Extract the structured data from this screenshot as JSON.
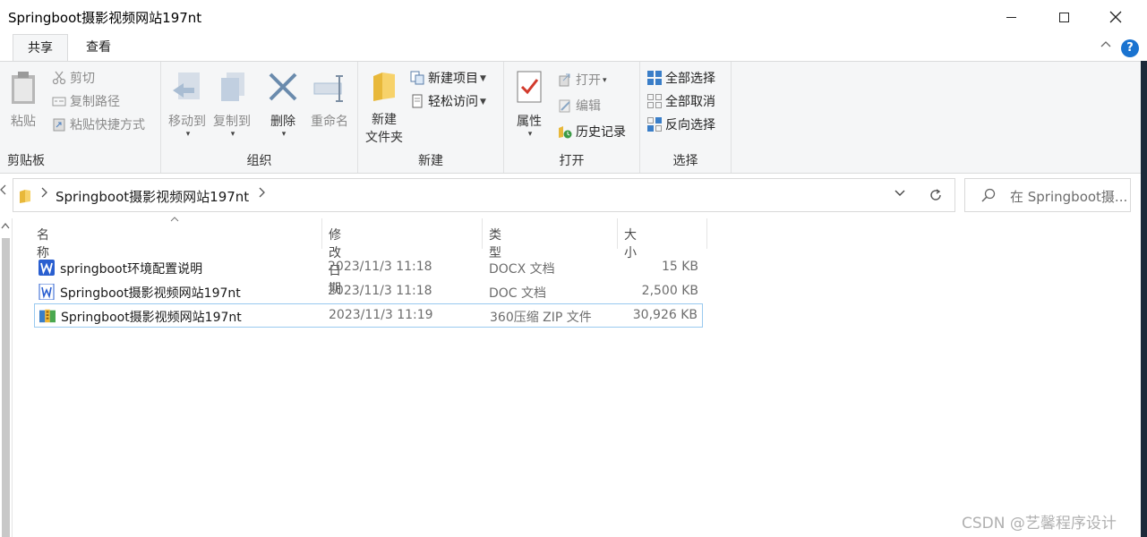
{
  "window": {
    "title": "Springboot摄影视频网站197nt"
  },
  "tabs": [
    {
      "label": "共享"
    },
    {
      "label": "查看"
    }
  ],
  "ribbon": {
    "clipboard": {
      "label": "剪贴板",
      "paste": "粘贴",
      "cut": "剪切",
      "copy_path": "复制路径",
      "paste_shortcut": "粘贴快捷方式"
    },
    "organize": {
      "label": "组织",
      "move_to": "移动到",
      "copy_to": "复制到",
      "delete": "删除",
      "rename": "重命名"
    },
    "new": {
      "label": "新建",
      "new_folder_line1": "新建",
      "new_folder_line2": "文件夹",
      "new_item": "新建项目",
      "easy_access": "轻松访问"
    },
    "open": {
      "label": "打开",
      "properties": "属性",
      "open": "打开",
      "edit": "编辑",
      "history": "历史记录"
    },
    "select": {
      "label": "选择",
      "select_all": "全部选择",
      "select_none": "全部取消",
      "invert": "反向选择"
    }
  },
  "address": {
    "crumb": "Springboot摄影视频网站197nt"
  },
  "search": {
    "placeholder": "在 Springboot摄..."
  },
  "columns": {
    "name": "名称",
    "date": "修改日期",
    "type": "类型",
    "size": "大小"
  },
  "files": [
    {
      "name": "springboot环境配置说明",
      "date": "2023/11/3 11:18",
      "type": "DOCX 文档",
      "size": "15 KB",
      "icon": "wps-word-icon"
    },
    {
      "name": "Springboot摄影视频网站197nt",
      "date": "2023/11/3 11:18",
      "type": "DOC 文档",
      "size": "2,500 KB",
      "icon": "word-doc-icon"
    },
    {
      "name": "Springboot摄影视频网站197nt",
      "date": "2023/11/3 11:19",
      "type": "360压缩 ZIP 文件",
      "size": "30,926 KB",
      "icon": "zip-archive-icon"
    }
  ],
  "watermark": "CSDN @艺馨程序设计",
  "colors": {
    "accent": "#1a73d0",
    "selection_border": "#99c9ef",
    "ribbon_bg": "#f5f6f7"
  }
}
